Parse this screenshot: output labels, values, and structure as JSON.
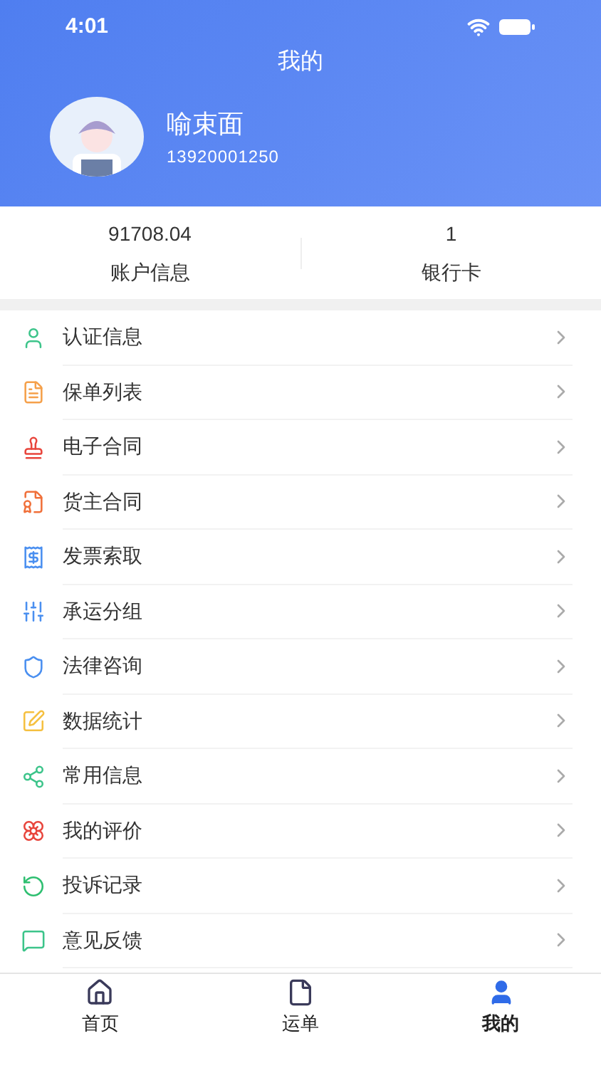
{
  "status_bar": {
    "time": "4:01"
  },
  "header": {
    "title": "我的"
  },
  "profile": {
    "name": "喻束面",
    "phone": "13920001250"
  },
  "stats": [
    {
      "value": "91708.04",
      "label": "账户信息"
    },
    {
      "value": "1",
      "label": "银行卡"
    }
  ],
  "menu": [
    {
      "label": "认证信息",
      "color": "#3cc48a"
    },
    {
      "label": "保单列表",
      "color": "#f5a04a"
    },
    {
      "label": "电子合同",
      "color": "#e8453c"
    },
    {
      "label": "货主合同",
      "color": "#f0703a"
    },
    {
      "label": "发票索取",
      "color": "#4a8ff0"
    },
    {
      "label": "承运分组",
      "color": "#4a8ff0"
    },
    {
      "label": "法律咨询",
      "color": "#4a8ff0"
    },
    {
      "label": "数据统计",
      "color": "#f5c040"
    },
    {
      "label": "常用信息",
      "color": "#3cc48a"
    },
    {
      "label": "我的评价",
      "color": "#e8453c"
    },
    {
      "label": "投诉记录",
      "color": "#2fbf71"
    },
    {
      "label": "意见反馈",
      "color": "#3cc48a"
    }
  ],
  "tabs": [
    {
      "label": "首页",
      "selected": false
    },
    {
      "label": "运单",
      "selected": false
    },
    {
      "label": "我的",
      "selected": true
    }
  ]
}
